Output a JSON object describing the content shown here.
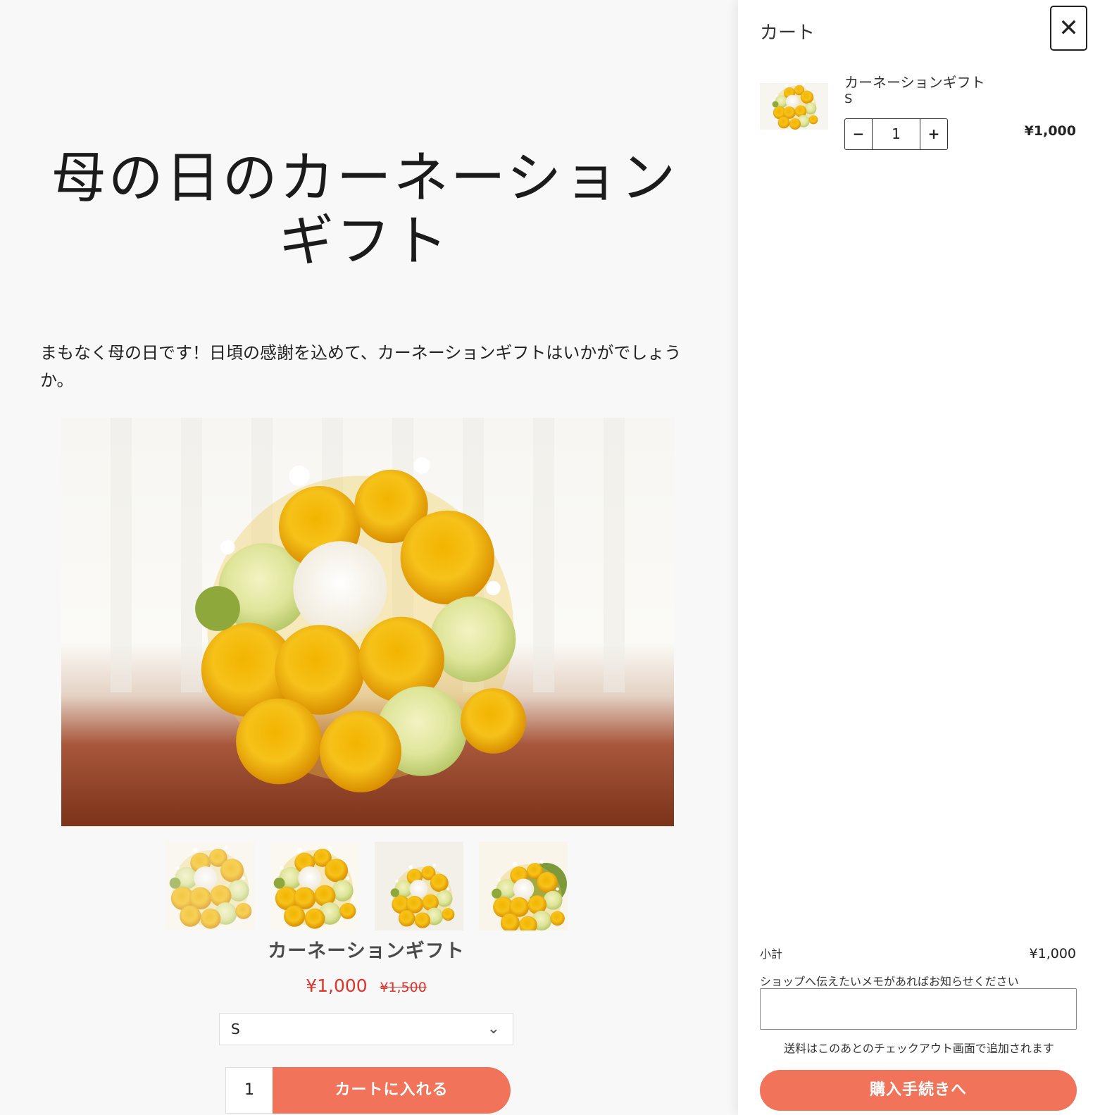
{
  "product": {
    "title_line1": "母の日のカーネーション",
    "title_line2": "ギフト",
    "description": "まもなく母の日です！日頃の感謝を込めて、カーネーションギフトはいかがでしょうか。",
    "name": "カーネーションギフト",
    "price": "¥1,000",
    "compare_price": "¥1,500",
    "variant_selected": "S",
    "quantity": "1",
    "add_to_cart_label": "カートに入れる",
    "thumbnails": 4
  },
  "cart": {
    "title": "カート",
    "close_icon": "close-icon",
    "item": {
      "name": "カーネーションギフト",
      "variant": "S",
      "quantity": "1",
      "minus_label": "−",
      "plus_label": "+",
      "price": "¥1,000"
    },
    "subtotal_label": "小計",
    "subtotal_value": "¥1,000",
    "memo_label": "ショップへ伝えたいメモがあればお知らせください",
    "memo_value": "",
    "shipping_note": "送料はこのあとのチェックアウト画面で追加されます",
    "checkout_label": "購入手続きへ"
  },
  "colors": {
    "accent": "#f1735a",
    "sale_price": "#e0332b",
    "background": "#f8f8f8"
  }
}
